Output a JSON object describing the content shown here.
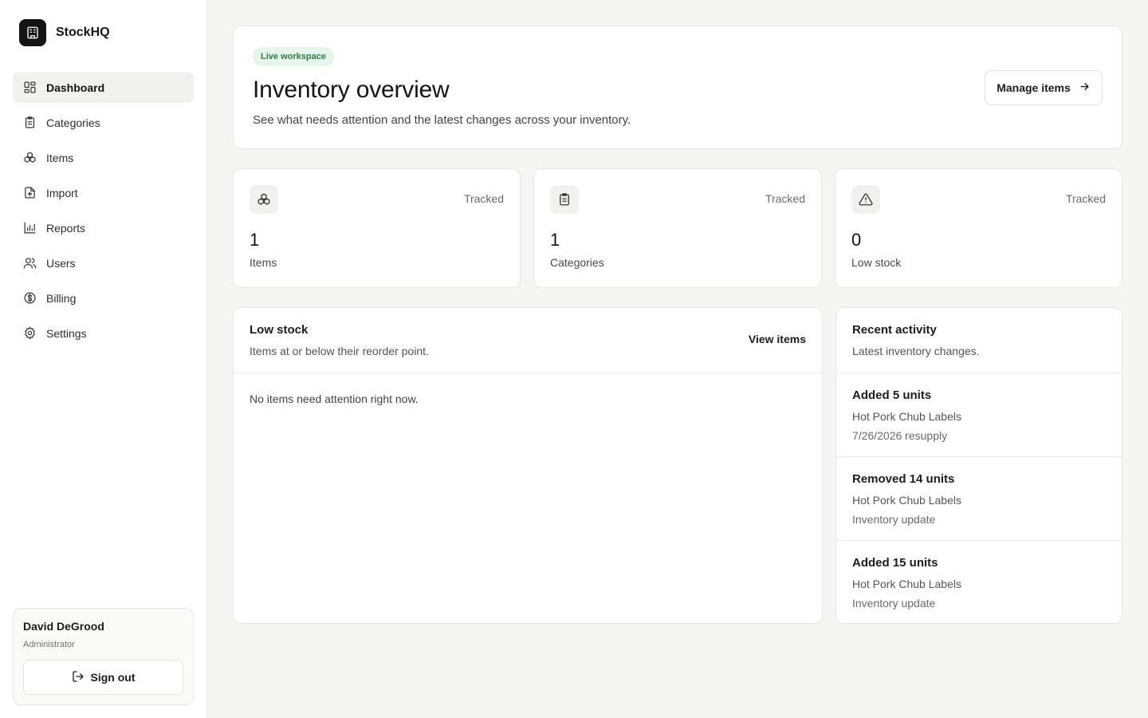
{
  "app": {
    "name": "StockHQ",
    "logo_icon": "building-icon"
  },
  "sidebar": {
    "items": [
      {
        "label": "Dashboard",
        "icon": "dashboard-icon",
        "active": true
      },
      {
        "label": "Categories",
        "icon": "clipboard-icon",
        "active": false
      },
      {
        "label": "Items",
        "icon": "boxes-icon",
        "active": false
      },
      {
        "label": "Import",
        "icon": "file-import-icon",
        "active": false
      },
      {
        "label": "Reports",
        "icon": "bar-chart-icon",
        "active": false
      },
      {
        "label": "Users",
        "icon": "users-icon",
        "active": false
      },
      {
        "label": "Billing",
        "icon": "dollar-circle-icon",
        "active": false
      },
      {
        "label": "Settings",
        "icon": "gear-icon",
        "active": false
      }
    ],
    "user": {
      "name": "David DeGrood",
      "role": "Administrator",
      "signout_label": "Sign out"
    }
  },
  "header": {
    "badge": "Live workspace",
    "title": "Inventory overview",
    "subtitle": "See what needs attention and the latest changes across your inventory.",
    "manage_label": "Manage items"
  },
  "stats": [
    {
      "tag": "Tracked",
      "value": "1",
      "label": "Items",
      "icon": "boxes-icon"
    },
    {
      "tag": "Tracked",
      "value": "1",
      "label": "Categories",
      "icon": "clipboard-icon"
    },
    {
      "tag": "Tracked",
      "value": "0",
      "label": "Low stock",
      "icon": "alert-triangle-icon"
    }
  ],
  "low_stock": {
    "title": "Low stock",
    "subtitle": "Items at or below their reorder point.",
    "link_label": "View items",
    "empty_text": "No items need attention right now."
  },
  "activity": {
    "title": "Recent activity",
    "subtitle": "Latest inventory changes.",
    "items": [
      {
        "title": "Added 5 units",
        "item": "Hot Pork Chub Labels",
        "note": "7/26/2026 resupply"
      },
      {
        "title": "Removed 14 units",
        "item": "Hot Pork Chub Labels",
        "note": "Inventory update"
      },
      {
        "title": "Added 15 units",
        "item": "Hot Pork Chub Labels",
        "note": "Inventory update"
      }
    ]
  },
  "colors": {
    "background": "#f5f5f3",
    "badge_bg": "#e7f6ea",
    "badge_text": "#2f7d45",
    "logo_bg": "#141414"
  }
}
